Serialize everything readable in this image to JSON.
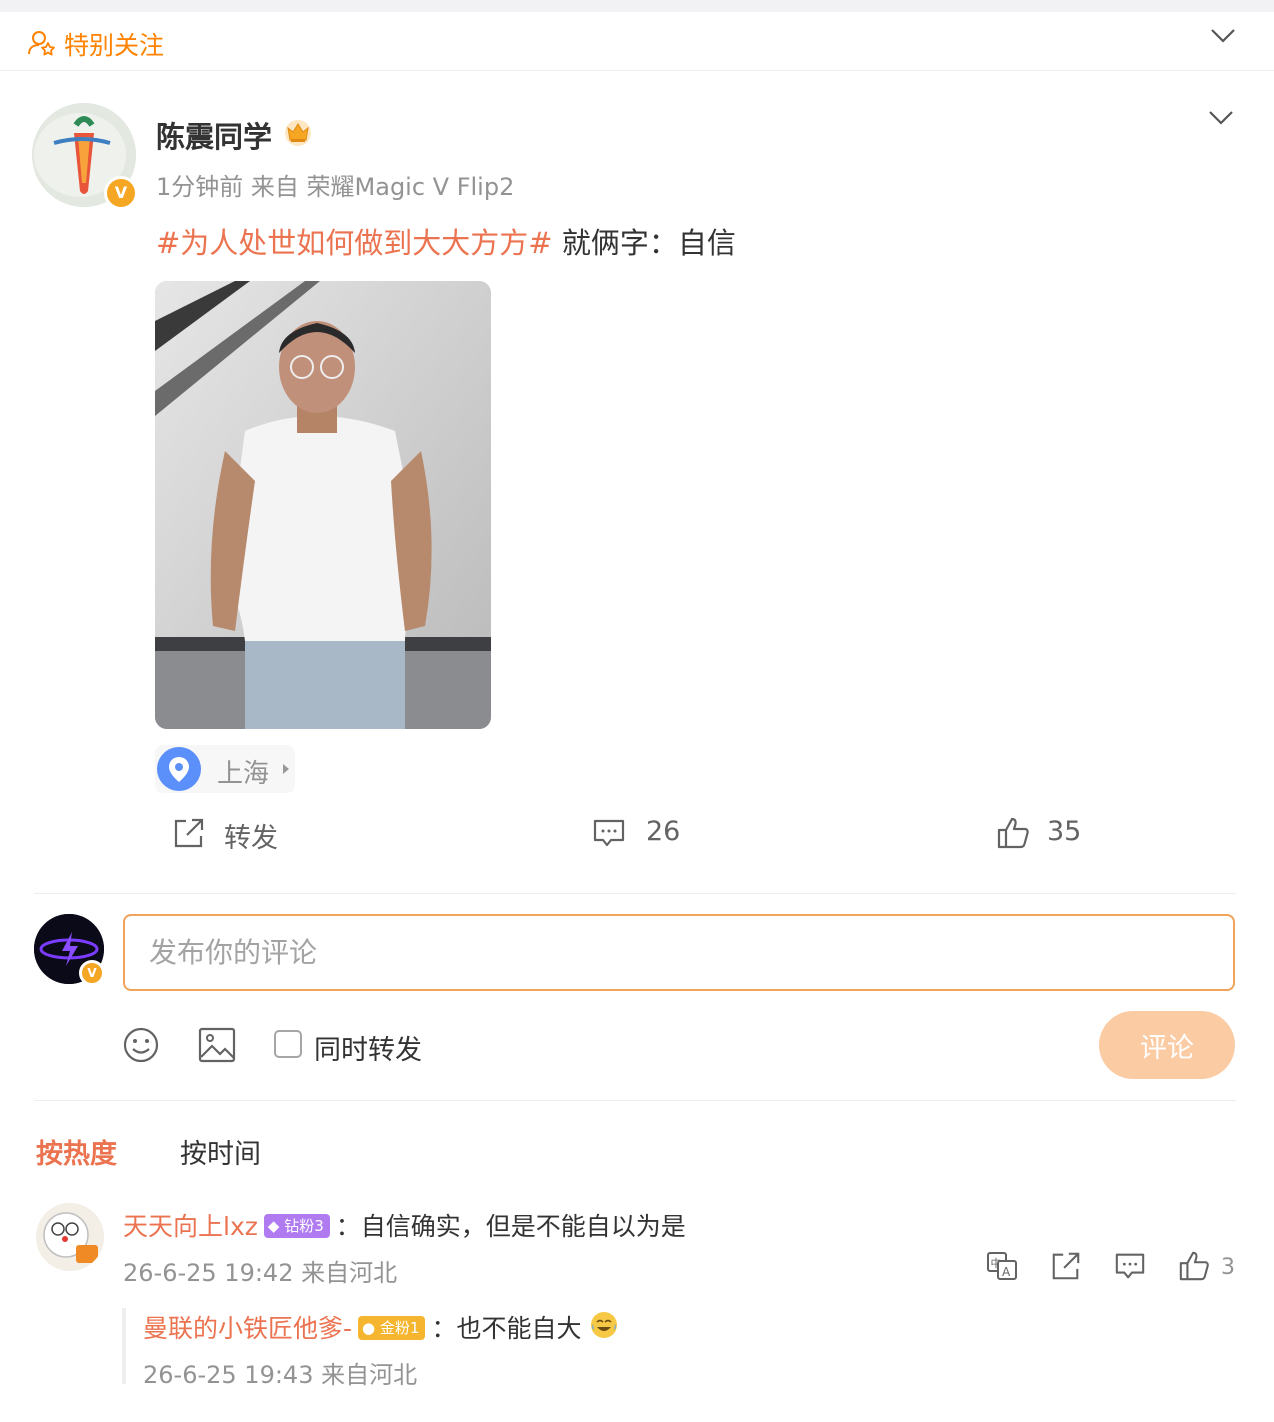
{
  "special_follow": {
    "label": "特别关注"
  },
  "post": {
    "author": "陈震同学",
    "meta": "1分钟前 来自 荣耀Magic V Flip2",
    "topic": "#为人处世如何做到大大方方#",
    "text": "就俩字：自信",
    "location": "上海"
  },
  "actions": {
    "repost_label": "转发",
    "comment_count": "26",
    "like_count": "35"
  },
  "composer": {
    "placeholder": "发布你的评论",
    "also_repost_label": "同时转发",
    "submit_label": "评论"
  },
  "sort": {
    "hot_label": "按热度",
    "time_label": "按时间"
  },
  "comments": [
    {
      "user": "天天向上lxz",
      "badge": "钻粉3",
      "text": "：自信确实，但是不能自以为是",
      "time": "26-6-25 19:42 来自河北",
      "like_count": "3",
      "reply": {
        "user": "曼联的小铁匠他爹-",
        "badge": "金粉1",
        "text": "：也不能自大",
        "time": "26-6-25 19:43 来自河北"
      }
    }
  ],
  "colors": {
    "accent": "#ff8200",
    "link": "#eb7350",
    "submit_disabled": "#fbcba4",
    "input_border": "#f0a35b"
  }
}
